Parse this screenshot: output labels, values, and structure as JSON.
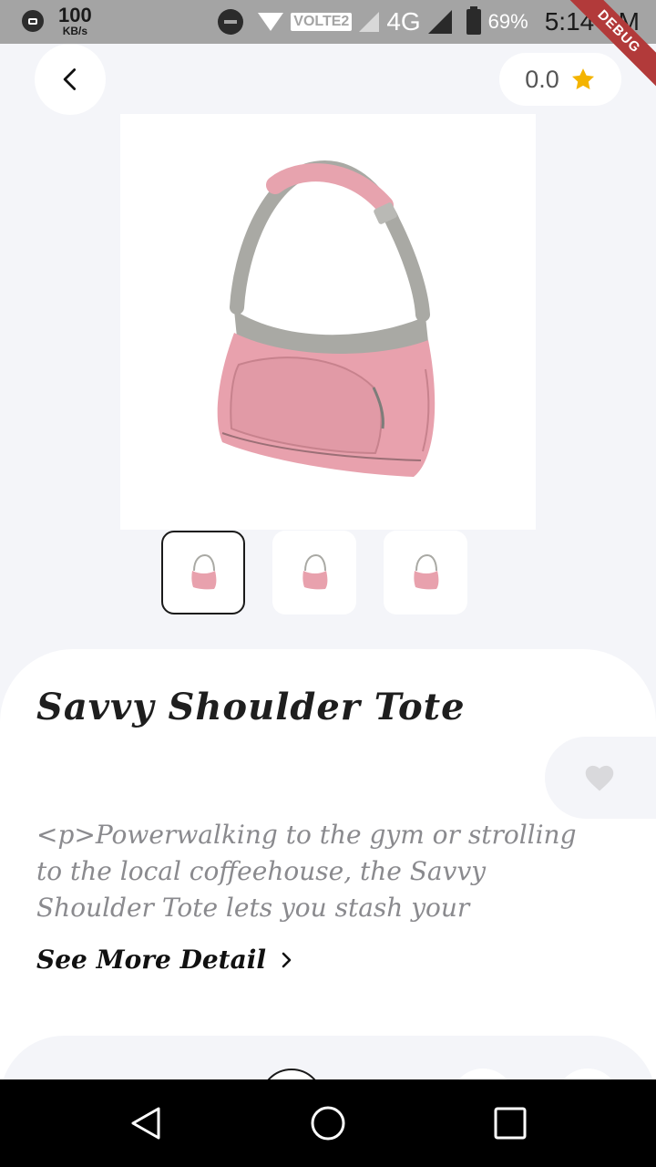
{
  "status_bar": {
    "speed_value": "100",
    "speed_unit": "KB/s",
    "volte": "VOLTE2",
    "network": "4G",
    "battery": "69%",
    "time": "5:14 PM",
    "debug": "DEBUG"
  },
  "rating": {
    "value": "0.0"
  },
  "product": {
    "title": "Savvy Shoulder Tote",
    "description": "<p>Powerwalking to the gym or strolling to the local coffeehouse, the Savvy Shoulder Tote lets you stash your",
    "see_more_label": "See More Detail",
    "image_icon": "pink-shoulder-bag",
    "thumbnails": [
      "thumb-1",
      "thumb-2",
      "thumb-3"
    ],
    "selected_thumbnail": 1
  },
  "colors": {
    "accent": "#f4b400",
    "background": "#f4f5f9",
    "bag_pink": "#e8a1ad",
    "bag_gray": "#a9a9a4"
  }
}
